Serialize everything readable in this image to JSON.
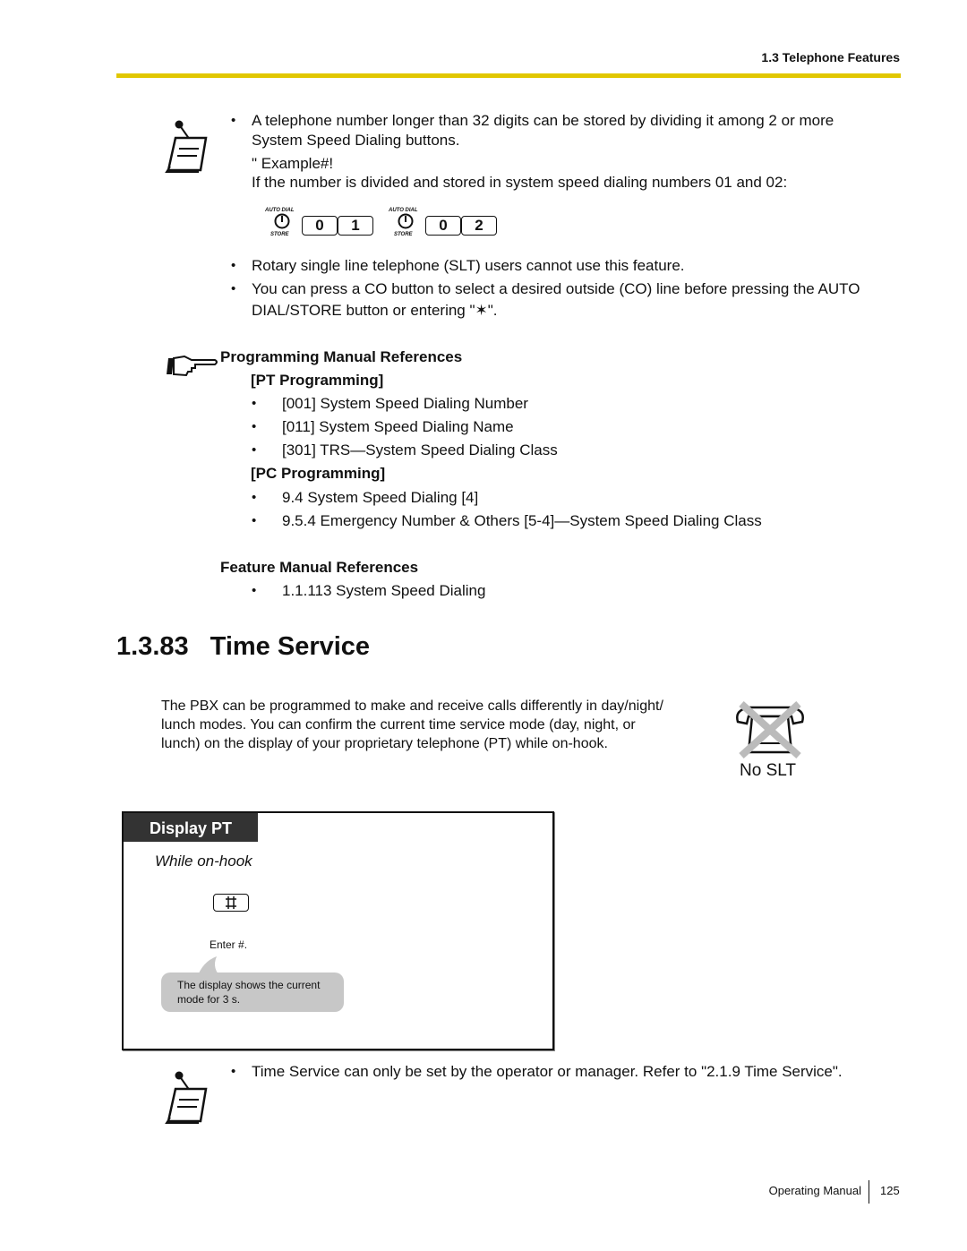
{
  "header": {
    "section": "1.3 Telephone Features",
    "rule_color": "#e1c700"
  },
  "note1": {
    "bullet": "•",
    "line1": "A telephone number longer than 32 digits can be stored by dividing it among 2 or more",
    "line2": "System Speed Dialing buttons.",
    "example_label": "\" Example#!",
    "example_desc": "If the number is divided and stored in system speed dialing numbers 01 and 02:",
    "sequence": [
      {
        "auto_dial": "AUTO DIAL",
        "store": "STORE",
        "keys": [
          "0",
          "1"
        ]
      },
      {
        "auto_dial": "AUTO DIAL",
        "store": "STORE",
        "keys": [
          "0",
          "2"
        ]
      }
    ],
    "bullets": [
      "Rotary single line telephone (SLT) users cannot use this feature.",
      "You can press a CO button to select a desired outside (CO) line before pressing the AUTO",
      "DIAL/STORE button or entering \"✶\"."
    ]
  },
  "references": {
    "programming_heading": "Programming Manual References",
    "pt_heading": "[PT Programming]",
    "pt_items": [
      "[001] System Speed Dialing Number",
      "[011] System Speed Dialing Name",
      "[301] TRS—System Speed Dialing Class"
    ],
    "pc_heading": "[PC Programming]",
    "pc_items": [
      "9.4 System Speed Dialing [4]",
      "9.5.4 Emergency Number & Others [5-4]—System Speed Dialing Class"
    ],
    "feature_heading": "Feature Manual References",
    "feature_items": [
      "1.1.113 System Speed Dialing"
    ]
  },
  "section": {
    "number": "1.3.83",
    "title": "Time Service",
    "intro_lines": [
      "The PBX can be programmed to make and receive calls differently in day/night/",
      "lunch modes. You can confirm the current time service mode (day, night, or",
      "lunch) on the display of your proprietary telephone (PT) while on-hook."
    ],
    "no_slt_label": "No SLT"
  },
  "display_box": {
    "tab_label": "Display PT",
    "condition": "While on-hook",
    "key_symbol": "#",
    "step_label": "Enter #.",
    "bubble_lines": [
      "The display shows the current",
      "mode for 3 s."
    ]
  },
  "note2": {
    "bullet": "•",
    "text": "Time Service can only be set by the operator or manager. Refer to \"2.1.9 Time Service\"."
  },
  "footer": {
    "label": "Operating Manual",
    "page": "125"
  }
}
